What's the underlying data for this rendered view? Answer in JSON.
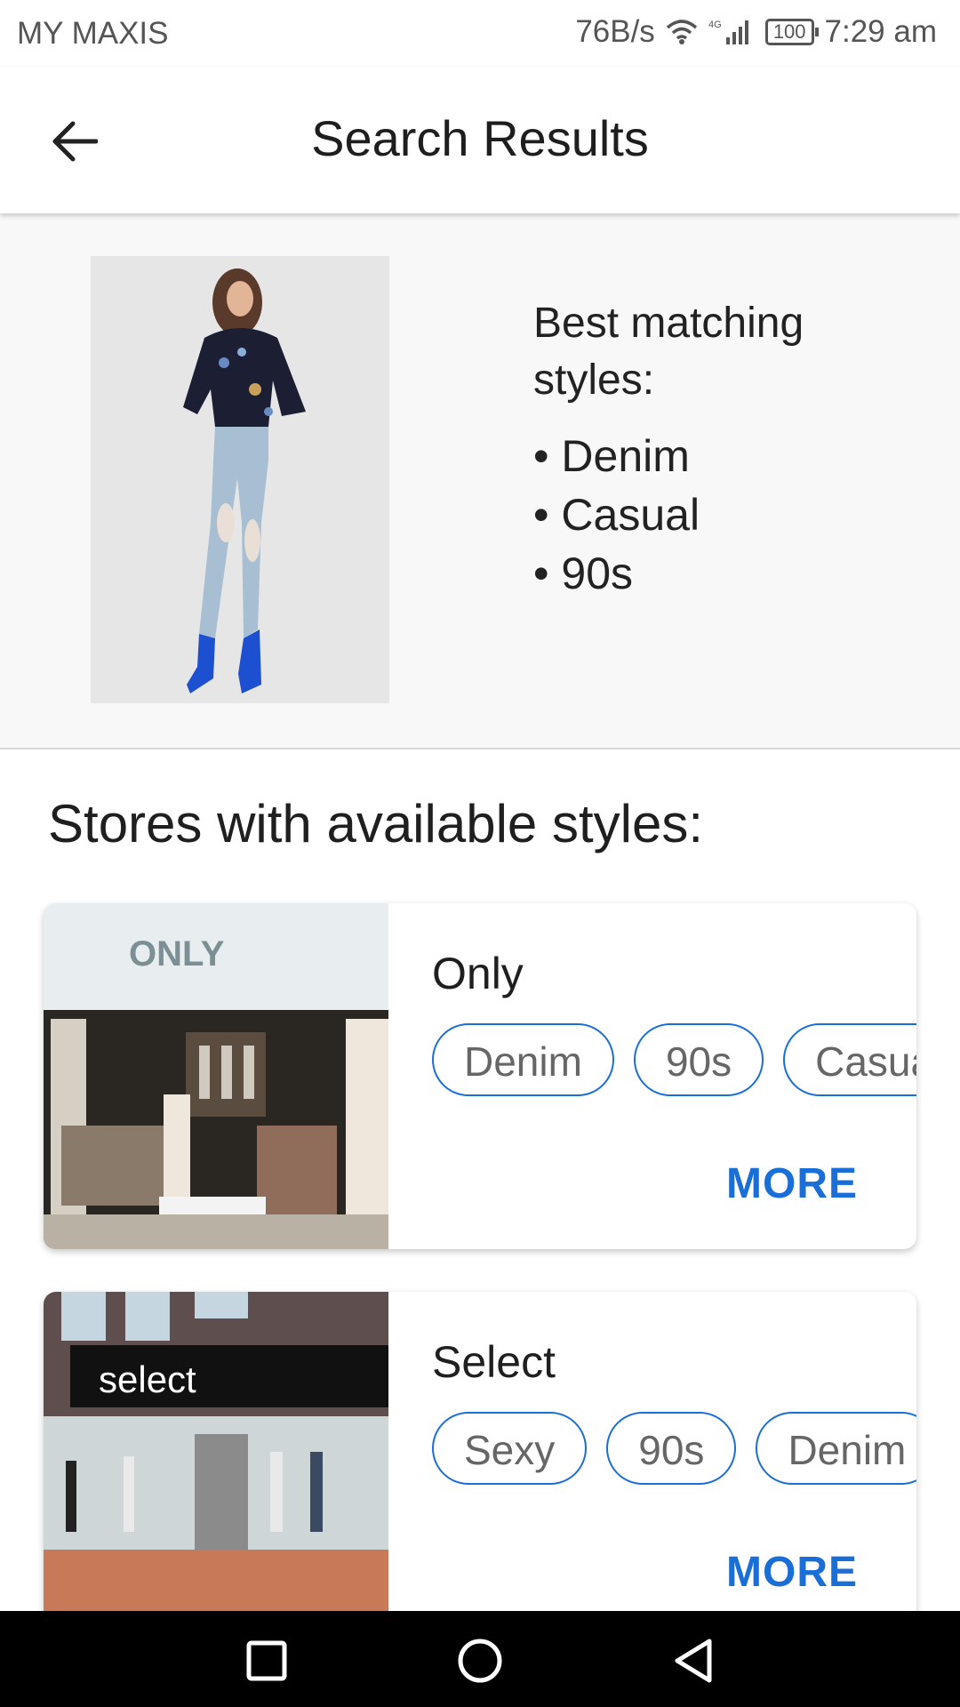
{
  "status_bar": {
    "carrier": "MY MAXIS",
    "speed": "76B/s",
    "network": "4G",
    "battery": "100",
    "time": "7:29 am"
  },
  "app_bar": {
    "title": "Search Results"
  },
  "match": {
    "heading": "Best matching styles:",
    "styles": [
      "Denim",
      "Casual",
      "90s"
    ]
  },
  "stores_heading": "Stores with available styles:",
  "stores": [
    {
      "name": "Only",
      "tags": [
        "Denim",
        "90s",
        "Casual"
      ],
      "more": "MORE",
      "sign": "ONLY"
    },
    {
      "name": "Select",
      "tags": [
        "Sexy",
        "90s",
        "Denim"
      ],
      "more": "MORE",
      "sign": "select"
    }
  ],
  "colors": {
    "accent": "#1a6ed8",
    "nav_bar": "#000000",
    "section_bg": "#f8f8f8"
  },
  "icons": [
    "back-arrow-icon",
    "wifi-icon",
    "signal-icon",
    "battery-icon",
    "square-icon",
    "circle-icon",
    "triangle-back-icon"
  ]
}
